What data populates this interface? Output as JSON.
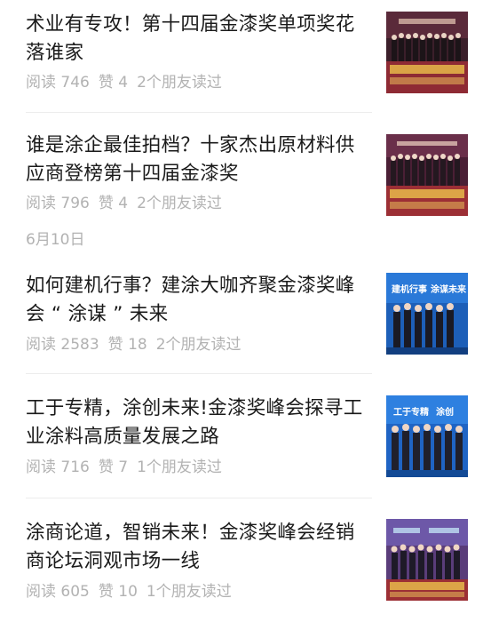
{
  "articles": [
    {
      "title": "术业有专攻！第十四届金漆奖单项奖花落谁家",
      "reads": "阅读 746",
      "likes": "赞 4",
      "friends": "2个朋友读过"
    },
    {
      "title": "谁是涂企最佳拍档？十家杰出原材料供应商登榜第十四届金漆奖",
      "reads": "阅读 796",
      "likes": "赞 4",
      "friends": "2个朋友读过"
    },
    {
      "title": "如何建机行事？建涂大咖齐聚金漆奖峰会 “ 涂谋 ” 未来",
      "reads": "阅读 2583",
      "likes": "赞 18",
      "friends": "2个朋友读过"
    },
    {
      "title": "工于专精，涂创未来!金漆奖峰会探寻工业涂料高质量发展之路",
      "reads": "阅读 716",
      "likes": "赞 7",
      "friends": "1个朋友读过"
    },
    {
      "title": "涂商论道，智销未来！金漆奖峰会经销商论坛洞观市场一线",
      "reads": "阅读 605",
      "likes": "赞 10",
      "friends": "1个朋友读过"
    }
  ],
  "date_separator": "6月10日",
  "thumbnails": {
    "thumb_3_banner_left": "建机行事",
    "thumb_3_banner_right": "涂谋未来",
    "thumb_4_banner_left": "工于专精",
    "thumb_4_banner_right": "涂创"
  },
  "colors": {
    "title_text": "#1a1a1a",
    "meta_text": "#b2b2b2",
    "divider": "#ececec",
    "thumb_stage_dark": "#3b1f2a",
    "thumb_stage_red": "#9c2f35",
    "thumb_stage_blue": "#1d5fb8",
    "thumb_stage_gold": "#e8b84a"
  }
}
